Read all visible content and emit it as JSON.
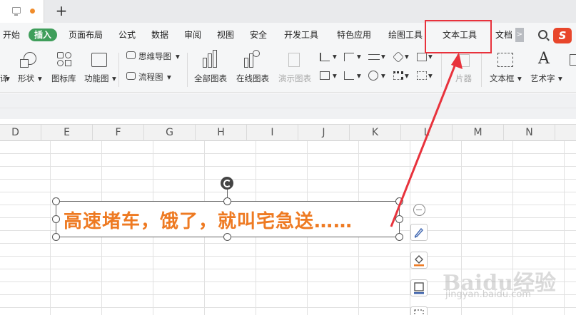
{
  "tabs": {
    "new_tab_symbol": "+"
  },
  "menu": {
    "items": [
      {
        "label": "开始"
      },
      {
        "label": "插入",
        "active": true
      },
      {
        "label": "页面布局"
      },
      {
        "label": "公式"
      },
      {
        "label": "数据"
      },
      {
        "label": "审阅"
      },
      {
        "label": "视图"
      },
      {
        "label": "安全"
      },
      {
        "label": "开发工具"
      },
      {
        "label": "特色应用"
      },
      {
        "label": "绘图工具"
      },
      {
        "label": "文本工具",
        "highlighted": true
      },
      {
        "label": "文档"
      }
    ],
    "scroll_symbol": ">",
    "sogou_symbol": "S",
    "accent_color": "#3f9e5b",
    "highlight_color": "#e8323c"
  },
  "ribbon": {
    "shape_left_label": "译",
    "shape_label": "形状",
    "icon_lib_label": "图标库",
    "func_chart_label": "功能图",
    "mindmap_label": "思维导图",
    "flowchart_label": "流程图",
    "all_charts_label": "全部图表",
    "online_charts_label": "在线图表",
    "demo_chart_label": "演示图表",
    "picture_label": "片器",
    "textbox_label": "文本框",
    "arttext_label": "艺术字"
  },
  "sheet": {
    "columns": [
      "D",
      "E",
      "F",
      "G",
      "H",
      "I",
      "J",
      "K",
      "L",
      "M",
      "N"
    ]
  },
  "textbox": {
    "text": "高速堵车，饿了，就叫宅急送……",
    "text_color": "#ee7a22"
  },
  "watermark": {
    "text": "Baidu经验",
    "sub": "jingyan.baidu.com"
  }
}
